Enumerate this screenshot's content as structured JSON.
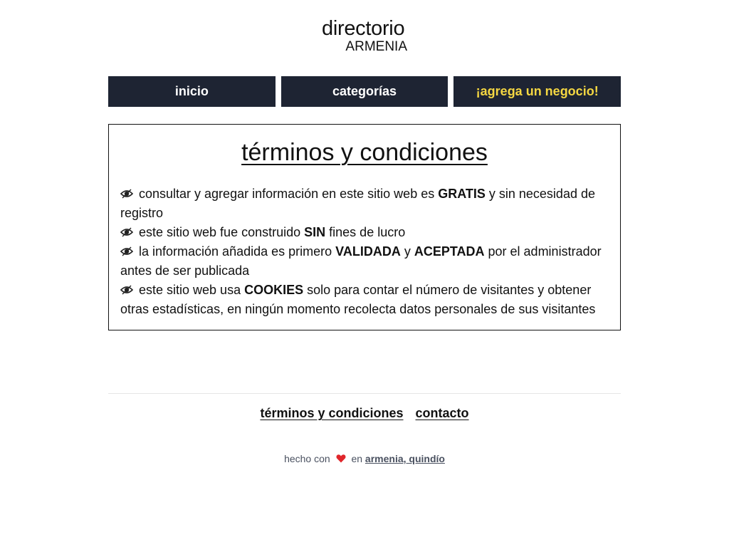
{
  "logo": {
    "main": "directorio",
    "sub": "ARMENIA"
  },
  "nav": {
    "items": [
      {
        "label": "inicio"
      },
      {
        "label": "categorías"
      },
      {
        "label": "¡agrega un negocio!"
      }
    ],
    "accent_color": "#f5d742",
    "bg_color": "#1e2433"
  },
  "main": {
    "title": "términos y condiciones",
    "icon": "eye-icon",
    "terms": [
      {
        "before": "consultar y agregar información en este sitio web es ",
        "bold": "GRATIS",
        "after": " y sin necesidad de registro"
      },
      {
        "before": "este sitio web fue construido ",
        "bold": "SIN",
        "after": " fines de lucro"
      },
      {
        "before": "la información añadida es primero ",
        "bold": "VALIDADA",
        "middle": " y ",
        "bold2": "ACEPTADA",
        "after": " por el administrador antes de ser publicada"
      },
      {
        "before": "este sitio web usa ",
        "bold": "COOKIES",
        "after": " solo para contar el número de visitantes y obtener otras estadísticas, en ningún momento recolecta datos personales de sus visitantes"
      }
    ]
  },
  "footer": {
    "links": [
      {
        "label": "términos y condiciones"
      },
      {
        "label": "contacto"
      }
    ],
    "made_prefix": "hecho con",
    "made_middle": "en",
    "made_location": "armenia, quindío",
    "heart_icon": "heart-icon"
  }
}
